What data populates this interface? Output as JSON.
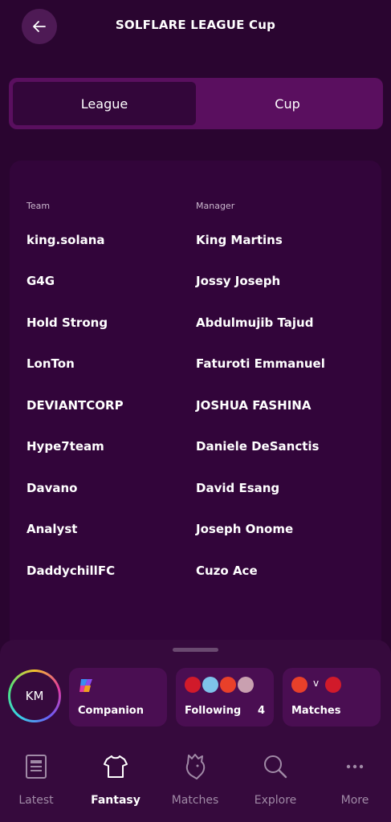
{
  "header": {
    "title": "SOLFLARE LEAGUE Cup",
    "back_icon": "arrow-left-icon"
  },
  "toggle": {
    "league_label": "League",
    "cup_label": "Cup",
    "selected": "League"
  },
  "table": {
    "team_header": "Team",
    "manager_header": "Manager",
    "rows": [
      {
        "team": "king.solana",
        "manager": "King Martins"
      },
      {
        "team": "G4G",
        "manager": "Jossy Joseph"
      },
      {
        "team": "Hold Strong",
        "manager": "Abdulmujib Tajud"
      },
      {
        "team": "LonTon",
        "manager": "Faturoti Emmanuel"
      },
      {
        "team": "DEVIANTCORP",
        "manager": "JOSHUA FASHINA"
      },
      {
        "team": "Hype7team",
        "manager": "Daniele DeSanctis"
      },
      {
        "team": "Davano",
        "manager": "David Esang"
      },
      {
        "team": "Analyst",
        "manager": "Joseph Onome"
      },
      {
        "team": "DaddychillFC",
        "manager": "Cuzo Ace"
      }
    ]
  },
  "quick": {
    "avatar_initials": "KM",
    "companion_label": "Companion",
    "following_label": "Following",
    "following_count": "4",
    "matches_label": "Matches",
    "matches_vs": "v"
  },
  "nav": {
    "items": [
      {
        "label": "Latest",
        "icon": "news-icon"
      },
      {
        "label": "Fantasy",
        "icon": "shirt-icon",
        "active": true
      },
      {
        "label": "Matches",
        "icon": "lion-icon"
      },
      {
        "label": "Explore",
        "icon": "search-icon"
      },
      {
        "label": "More",
        "icon": "more-dots-icon"
      }
    ]
  },
  "colors": {
    "background": "#2a0530",
    "card": "#32053a",
    "toggle_bg": "#5a0f5f",
    "accent_chip": "#4a0e52"
  }
}
